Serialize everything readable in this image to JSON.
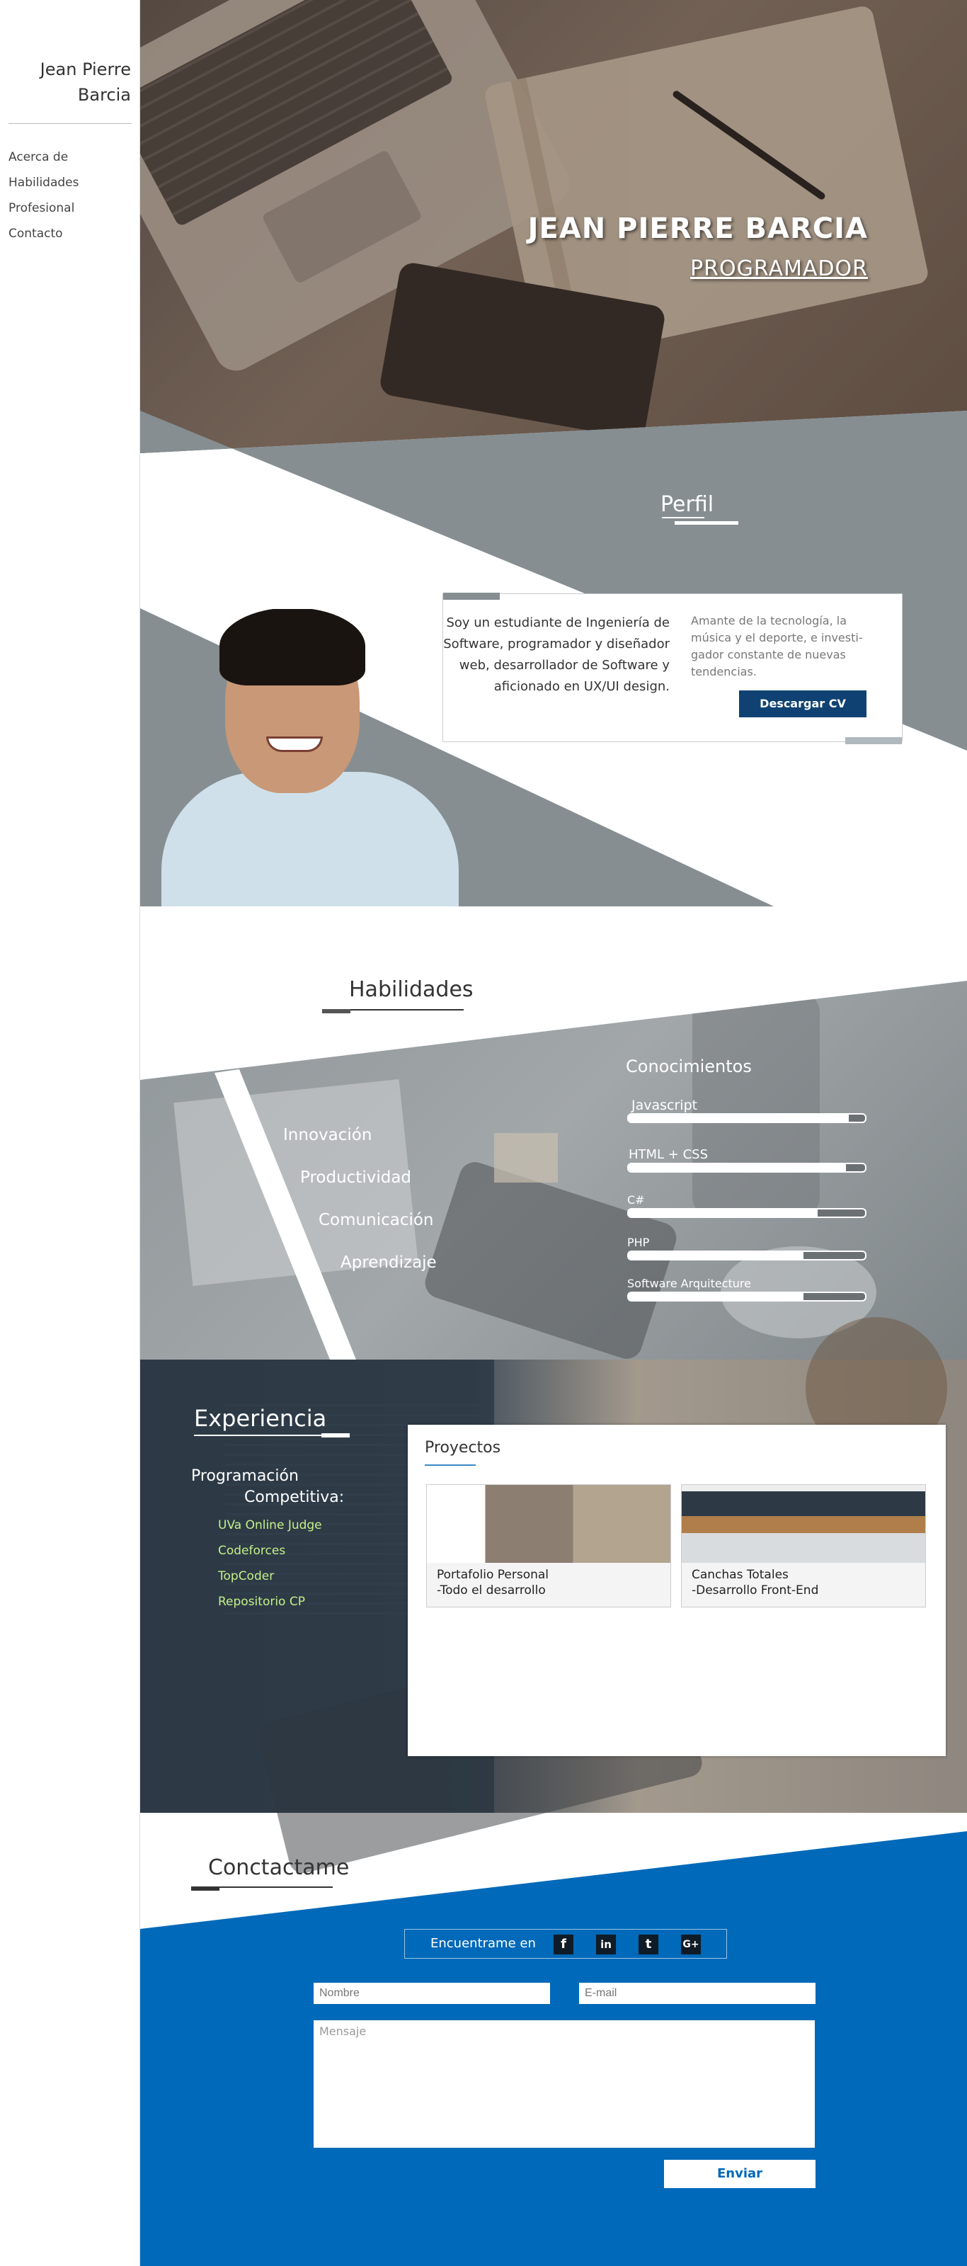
{
  "sidebar": {
    "name": "Jean Pierre Barcia",
    "nav": [
      "Acerca de",
      "Habilidades",
      "Profesional",
      "Contacto"
    ]
  },
  "hero": {
    "title": "JEAN PIERRE BARCIA",
    "subtitle": "PROGRAMADOR"
  },
  "perfil": {
    "heading": "Perfil",
    "bio": "Soy un estudiante de Ingeniería de Software, programador y diseñador web, desarrollador de Software y aficionado en UX/UI design.",
    "side_text": "Amante de la tecnología, la música y el deporte, e investi-gador constante de nuevas tendencias.",
    "cv_button": "Descargar CV"
  },
  "habilidades": {
    "heading": "Habilidades",
    "soft_skills": [
      "Innovación",
      "Productividad",
      "Comunicación",
      "Aprendizaje"
    ],
    "knowledge_heading": "Conocimientos",
    "skills": [
      {
        "name": "Javascript",
        "level": 0.93
      },
      {
        "name": "HTML + CSS",
        "level": 0.92
      },
      {
        "name": "C#",
        "level": 0.8
      },
      {
        "name": "PHP",
        "level": 0.74
      },
      {
        "name": "Software Arquitecture",
        "level": 0.74
      }
    ]
  },
  "experiencia": {
    "heading": "Experiencia",
    "competitive_line1": "Programación",
    "competitive_line2": "Competitiva:",
    "links": [
      "UVa Online Judge",
      "Codeforces",
      "TopCoder",
      "Repositorio CP"
    ],
    "projects_heading": "Proyectos",
    "projects": [
      {
        "title_line1": "Portafolio Personal",
        "title_line2": "-Todo el desarrollo"
      },
      {
        "title_line1": "Canchas Totales",
        "title_line2": "-Desarrollo Front-End"
      }
    ]
  },
  "contacto": {
    "heading": "Conctactame",
    "social_label": "Encuentrame en",
    "social_icons": [
      "f",
      "in",
      "t",
      "G+"
    ],
    "name_placeholder": "Nombre",
    "email_placeholder": "E-mail",
    "message_placeholder": "Mensaje",
    "send_button": "Enviar"
  },
  "colors": {
    "navy_button": "#0f4273",
    "contact_blue": "#0069b9",
    "slate": "#868e92",
    "link_green": "#c4f088"
  }
}
